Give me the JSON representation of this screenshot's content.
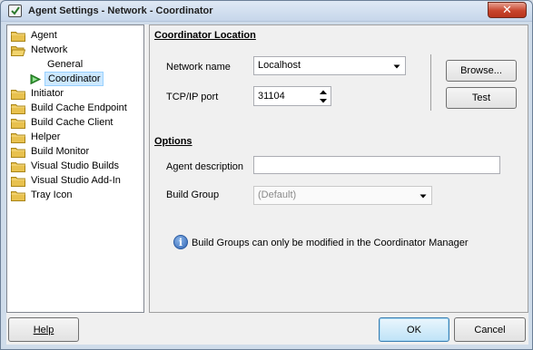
{
  "window": {
    "title": "Agent Settings - Network - Coordinator",
    "close_label": "✕"
  },
  "tree": {
    "items": [
      {
        "label": "Agent"
      },
      {
        "label": "Network"
      },
      {
        "label": "General"
      },
      {
        "label": "Coordinator",
        "selected": true
      },
      {
        "label": "Initiator"
      },
      {
        "label": "Build Cache Endpoint"
      },
      {
        "label": "Build Cache Client"
      },
      {
        "label": "Helper"
      },
      {
        "label": "Build Monitor"
      },
      {
        "label": "Visual Studio Builds"
      },
      {
        "label": "Visual Studio Add-In"
      },
      {
        "label": "Tray Icon"
      }
    ]
  },
  "coordinator": {
    "section_title": "Coordinator Location",
    "network_name_label": "Network name",
    "network_name_value": "Localhost",
    "tcp_port_label": "TCP/IP port",
    "tcp_port_value": "31104",
    "browse_label": "Browse...",
    "test_label": "Test"
  },
  "options": {
    "section_title": "Options",
    "agent_description_label": "Agent description",
    "agent_description_value": "",
    "build_group_label": "Build Group",
    "build_group_value": "(Default)"
  },
  "info": {
    "text": "Build Groups can only be modified in the Coordinator Manager"
  },
  "footer": {
    "help_label": "Help",
    "ok_label": "OK",
    "cancel_label": "Cancel"
  },
  "colors": {
    "folder": "#e8c14e",
    "selection": "#cce8ff",
    "arrow_green": "#3aa23a",
    "info_blue": "#2f64b4"
  }
}
